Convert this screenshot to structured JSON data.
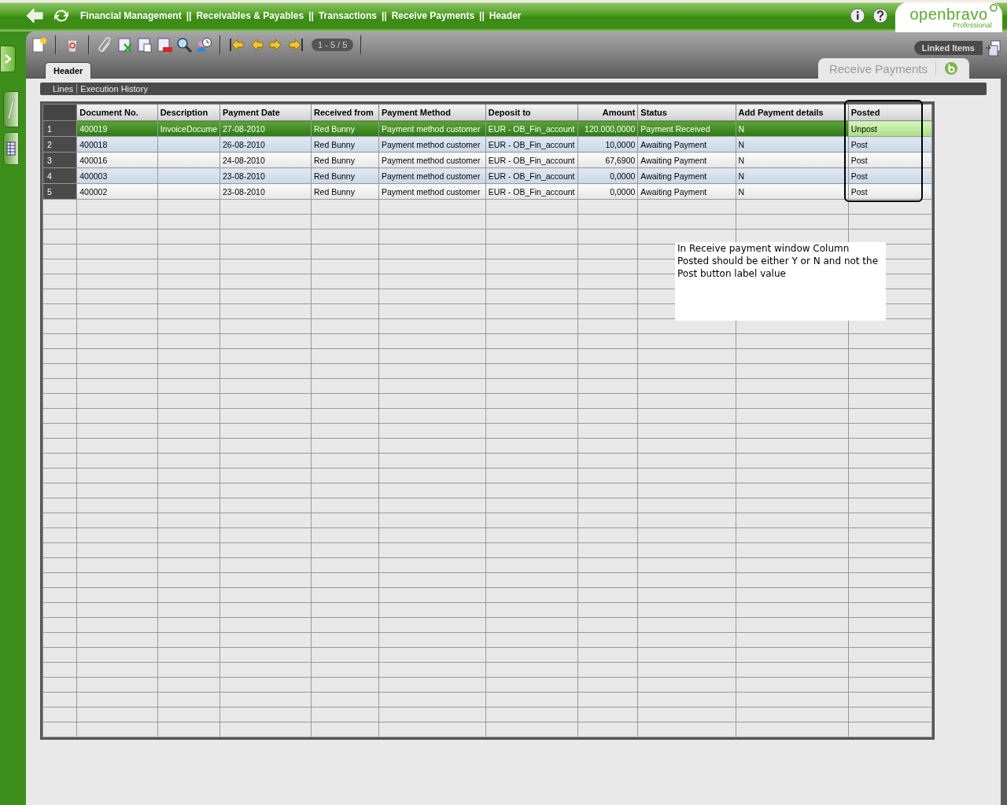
{
  "breadcrumb": [
    {
      "label": "Financial Management",
      "separator": "||"
    },
    {
      "label": "Receivables & Payables",
      "separator": "||"
    },
    {
      "label": "Transactions",
      "separator": "||"
    },
    {
      "label": "Receive Payments",
      "separator": "||"
    },
    {
      "label": "Header"
    }
  ],
  "pager": "1 - 5 / 5",
  "linked_items": "Linked Items",
  "logo": {
    "name": "openbravo",
    "edition": "Professional"
  },
  "window_tab": "Receive Payments",
  "tabs": [
    {
      "label": "Header",
      "selected": true
    }
  ],
  "subtabs": [
    "Lines",
    "Execution History"
  ],
  "table": {
    "columns": [
      {
        "label": "Document No.",
        "numeric": false
      },
      {
        "label": "Description",
        "numeric": false
      },
      {
        "label": "Payment Date",
        "numeric": false
      },
      {
        "label": "Received from",
        "numeric": false
      },
      {
        "label": "Payment Method",
        "numeric": false
      },
      {
        "label": "Deposit to",
        "numeric": false
      },
      {
        "label": "Amount",
        "numeric": true
      },
      {
        "label": "Status",
        "numeric": false
      },
      {
        "label": "Add Payment details",
        "numeric": false
      },
      {
        "label": "Posted",
        "numeric": false
      }
    ],
    "rows": [
      {
        "number": "1",
        "selected": true,
        "cells": [
          "400019",
          "InvoiceDocume",
          "27-08-2010",
          "Red Bunny",
          "Payment method customer",
          "EUR - OB_Fin_account",
          "120.000,0000",
          "Payment Received",
          "N",
          "Unpost"
        ]
      },
      {
        "number": "2",
        "selected": false,
        "cells": [
          "400018",
          "",
          "26-08-2010",
          "Red Bunny",
          "Payment method customer",
          "EUR - OB_Fin_account",
          "10,0000",
          "Awaiting Payment",
          "N",
          "Post"
        ]
      },
      {
        "number": "3",
        "selected": false,
        "cells": [
          "400016",
          "",
          "24-08-2010",
          "Red Bunny",
          "Payment method customer",
          "EUR - OB_Fin_account",
          "67,6900",
          "Awaiting Payment",
          "N",
          "Post"
        ]
      },
      {
        "number": "4",
        "selected": false,
        "cells": [
          "400003",
          "",
          "23-08-2010",
          "Red Bunny",
          "Payment method customer",
          "EUR - OB_Fin_account",
          "0,0000",
          "Awaiting Payment",
          "N",
          "Post"
        ]
      },
      {
        "number": "5",
        "selected": false,
        "cells": [
          "400002",
          "",
          "23-08-2010",
          "Red Bunny",
          "Payment method customer",
          "EUR - OB_Fin_account",
          "0,0000",
          "Awaiting Payment",
          "N",
          "Post"
        ]
      }
    ]
  },
  "annotation": "In Receive payment window Column Posted should be either Y or N and not the Post button label value"
}
